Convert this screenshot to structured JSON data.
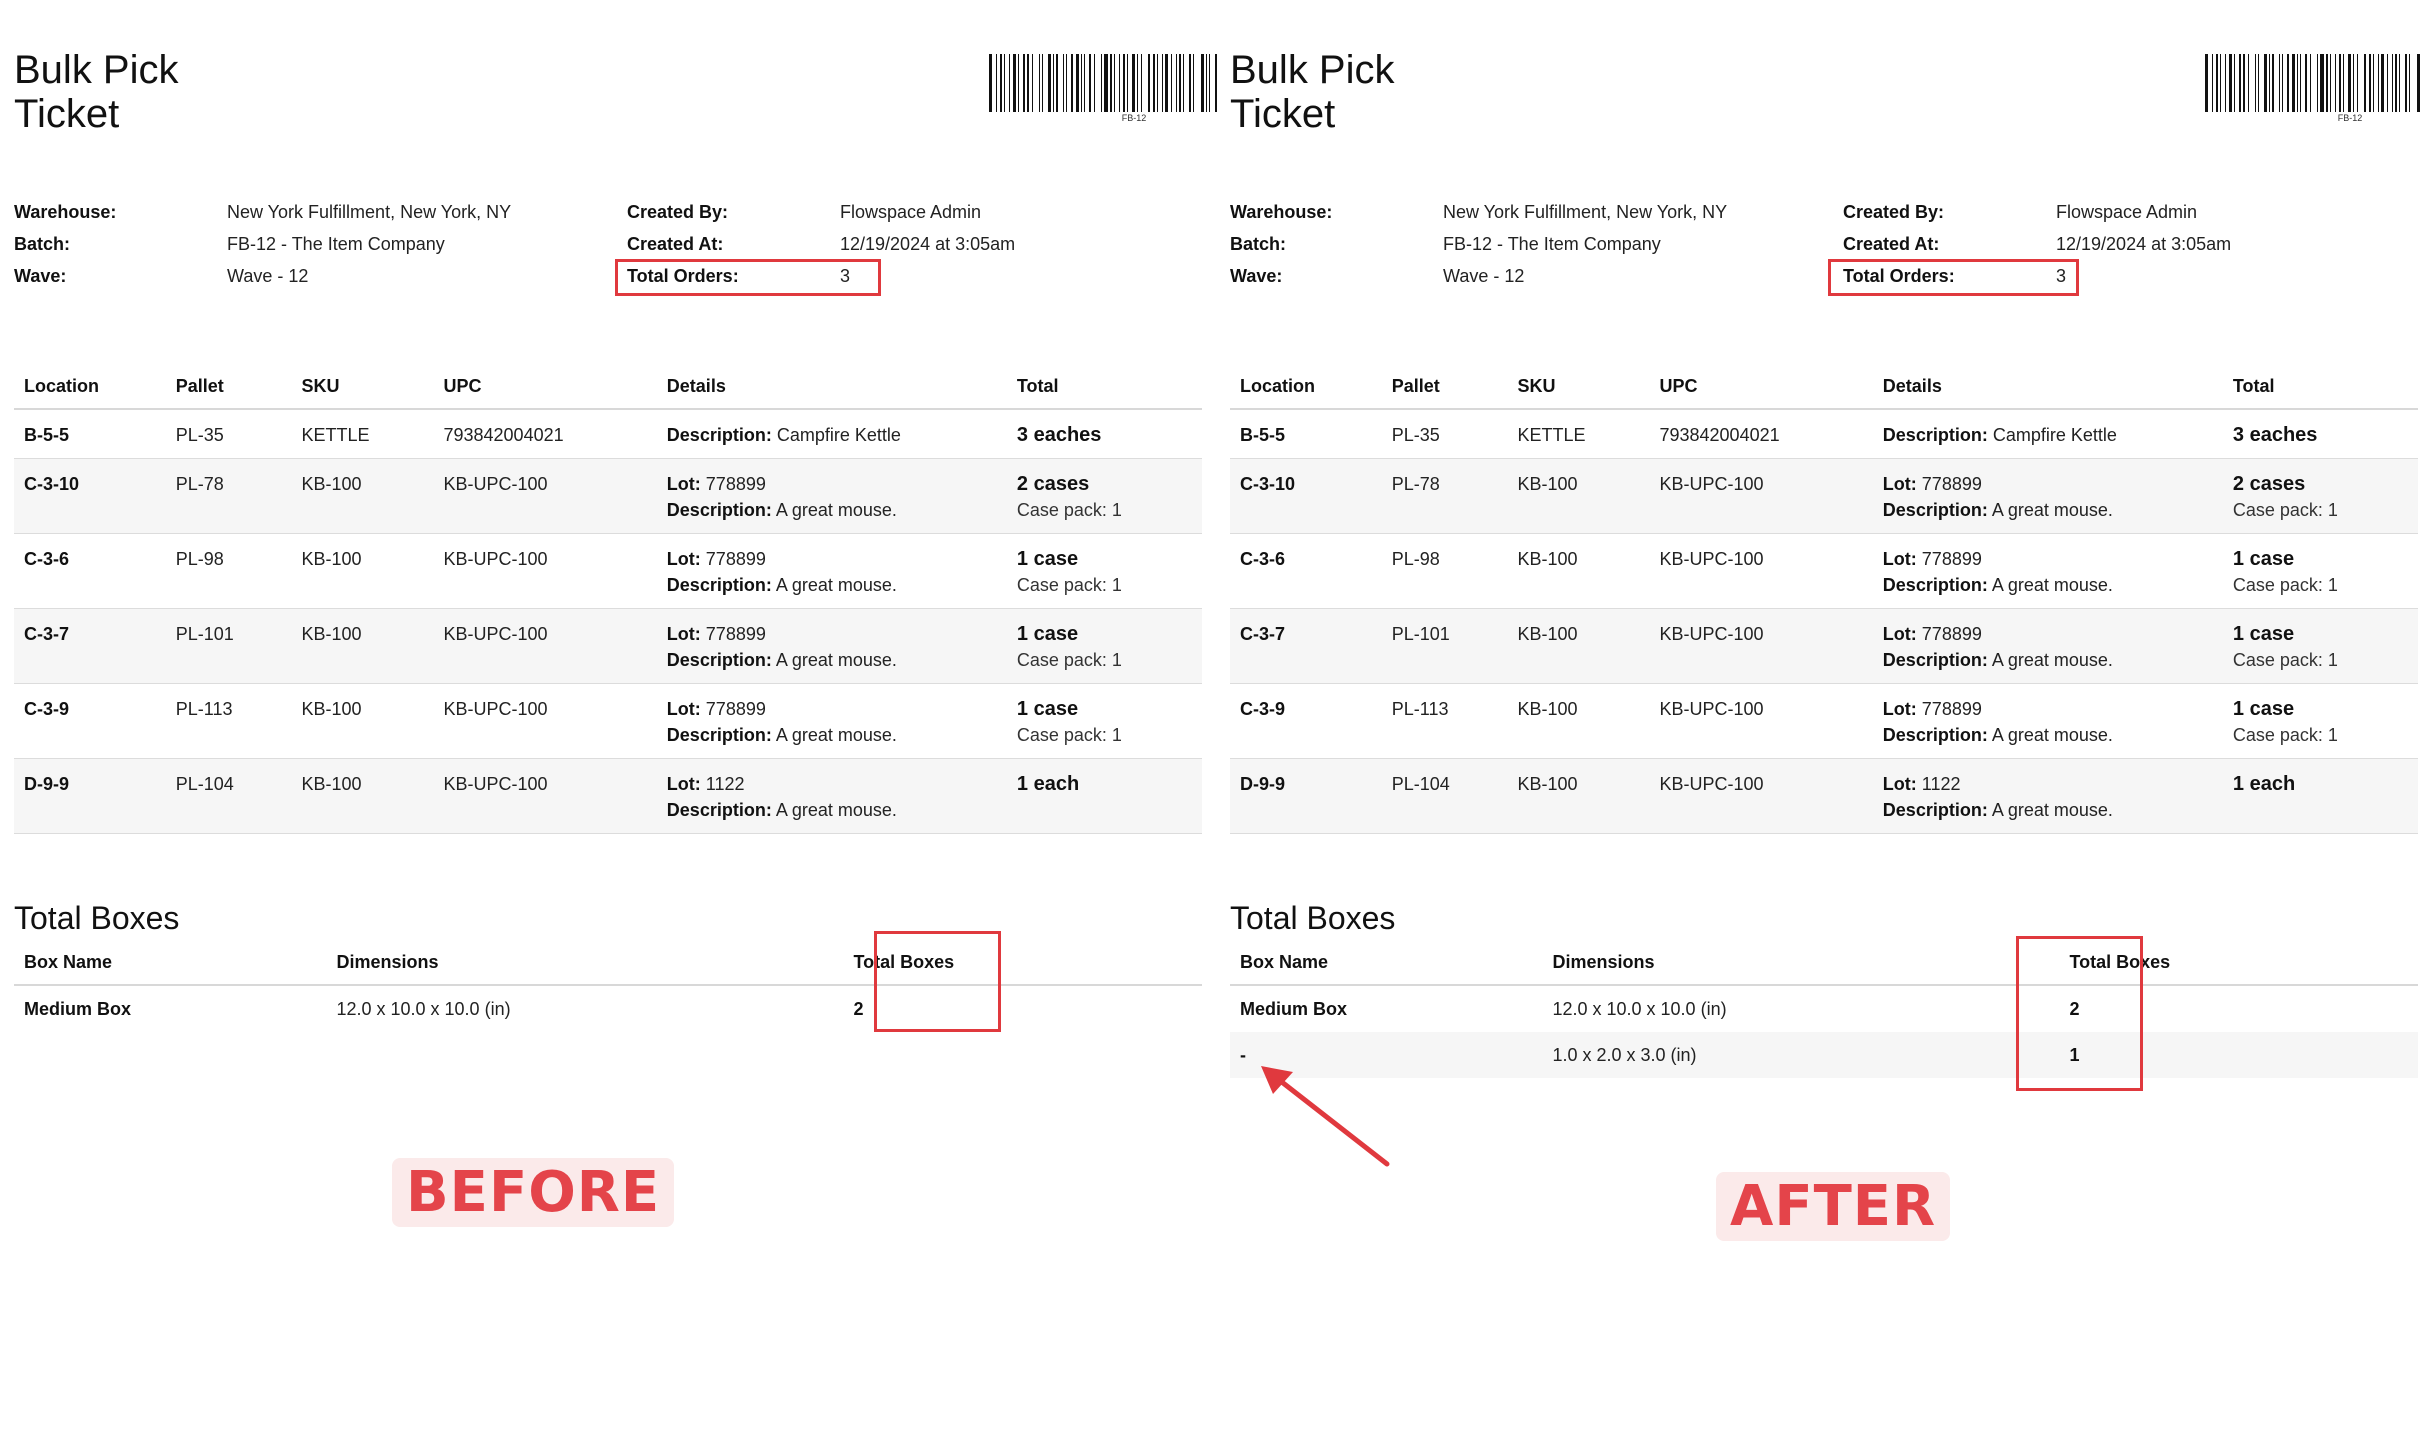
{
  "ticket": {
    "title_line1": "Bulk Pick",
    "title_line2": "Ticket",
    "barcode_text": "FB-12",
    "meta_left": [
      {
        "label": "Warehouse:",
        "value": "New York Fulfillment, New York, NY"
      },
      {
        "label": "Batch:",
        "value": "FB-12 - The Item Company"
      },
      {
        "label": "Wave:",
        "value": "Wave - 12"
      }
    ],
    "meta_right": [
      {
        "label": "Created By:",
        "value": "Flowspace Admin"
      },
      {
        "label": "Created At:",
        "value": "12/19/2024 at 3:05am"
      },
      {
        "label": "Total Orders:",
        "value": "3"
      }
    ],
    "item_columns": [
      "Location",
      "Pallet",
      "SKU",
      "UPC",
      "Details",
      "Total"
    ],
    "detail_labels": {
      "lot": "Lot:",
      "description": "Description:"
    },
    "items": [
      {
        "location": "B-5-5",
        "pallet": "PL-35",
        "sku": "KETTLE",
        "upc": "793842004021",
        "lot": "",
        "description": "Campfire Kettle",
        "total": "3 eaches",
        "case_pack": ""
      },
      {
        "location": "C-3-10",
        "pallet": "PL-78",
        "sku": "KB-100",
        "upc": "KB-UPC-100",
        "lot": "778899",
        "description": "A great mouse.",
        "total": "2 cases",
        "case_pack": "Case pack: 1"
      },
      {
        "location": "C-3-6",
        "pallet": "PL-98",
        "sku": "KB-100",
        "upc": "KB-UPC-100",
        "lot": "778899",
        "description": "A great mouse.",
        "total": "1 case",
        "case_pack": "Case pack: 1"
      },
      {
        "location": "C-3-7",
        "pallet": "PL-101",
        "sku": "KB-100",
        "upc": "KB-UPC-100",
        "lot": "778899",
        "description": "A great mouse.",
        "total": "1 case",
        "case_pack": "Case pack: 1"
      },
      {
        "location": "C-3-9",
        "pallet": "PL-113",
        "sku": "KB-100",
        "upc": "KB-UPC-100",
        "lot": "778899",
        "description": "A great mouse.",
        "total": "1 case",
        "case_pack": "Case pack: 1"
      },
      {
        "location": "D-9-9",
        "pallet": "PL-104",
        "sku": "KB-100",
        "upc": "KB-UPC-100",
        "lot": "1122",
        "description": "A great mouse.",
        "total": "1 each",
        "case_pack": ""
      }
    ],
    "boxes_title": "Total Boxes",
    "box_columns": [
      "Box Name",
      "Dimensions",
      "Total Boxes"
    ]
  },
  "before": {
    "label": "BEFORE",
    "boxes": [
      {
        "name": "Medium Box",
        "dimensions": "12.0 x 10.0 x 10.0 (in)",
        "total": "2"
      }
    ]
  },
  "after": {
    "label": "AFTER",
    "boxes": [
      {
        "name": "Medium Box",
        "dimensions": "12.0 x 10.0 x 10.0 (in)",
        "total": "2"
      },
      {
        "name": "-",
        "dimensions": "1.0 x 2.0 x 3.0 (in)",
        "total": "1"
      }
    ]
  },
  "colors": {
    "highlight": "#e0393e",
    "tag_text": "#e4444a",
    "tag_bg": "#fbeaea"
  }
}
